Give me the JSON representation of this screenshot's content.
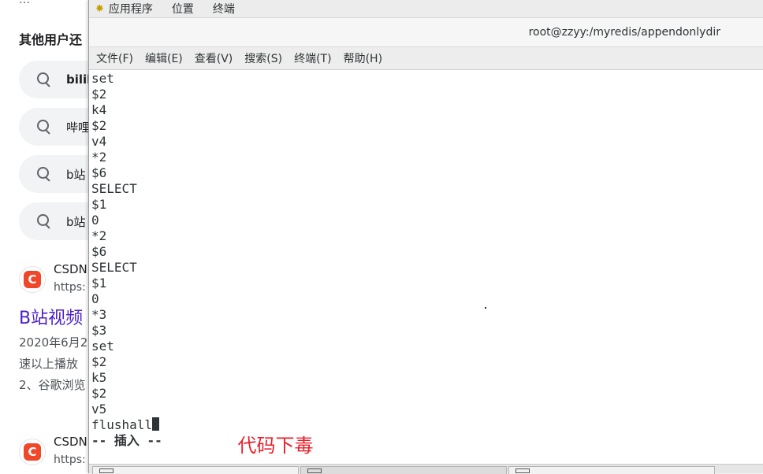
{
  "browser": {
    "top_snippet": "…",
    "other_users_heading": "其他用户还",
    "suggestions": [
      {
        "text": "bilil",
        "bold": true
      },
      {
        "text": "哔哩",
        "bold": false
      },
      {
        "text": "b站",
        "bold": false
      },
      {
        "text": "b站",
        "bold": false
      }
    ],
    "results": [
      {
        "site": "CSDN",
        "url": "https:"
      },
      {
        "site": "CSDN",
        "url": "https:"
      }
    ],
    "result_title": "B站视频",
    "result_lines": [
      "2020年6月2",
      "速以上播放",
      "2、谷歌浏览"
    ]
  },
  "terminal": {
    "topbar": {
      "applications": "应用程序",
      "places": "位置",
      "terminal": "终端"
    },
    "window_title": "root@zzyy:/myredis/appendonlydir",
    "menu": [
      "文件(F)",
      "编辑(E)",
      "查看(V)",
      "搜索(S)",
      "终端(T)",
      "帮助(H)"
    ],
    "lines": [
      "set",
      "$2",
      "k4",
      "$2",
      "v4",
      "*2",
      "$6",
      "SELECT",
      "$1",
      "0",
      "*2",
      "$6",
      "SELECT",
      "$1",
      "0",
      "*3",
      "$3",
      "set",
      "$2",
      "k5",
      "$2",
      "v5"
    ],
    "current_line": "flushall",
    "mode_line": "-- 插入 --"
  },
  "annotation": {
    "text": "代码下毒",
    "color": "#e8202a"
  },
  "icons": {
    "search": "search-icon",
    "csdn_logo": "csdn-logo-icon",
    "app_menu": "app-menu-icon",
    "cursor": "text-cursor"
  },
  "colors": {
    "link": "#4b1fc7",
    "annotation": "#e8202a",
    "csdn": "#f0462a"
  }
}
